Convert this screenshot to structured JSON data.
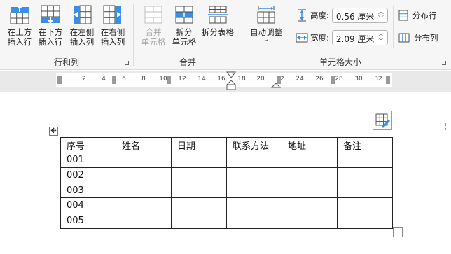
{
  "ribbon": {
    "rows_columns": {
      "group_label": "行和列",
      "buttons": [
        {
          "label": "在上方\n插入行",
          "icon": "insert-row-above-icon"
        },
        {
          "label": "在下方\n插入行",
          "icon": "insert-row-below-icon"
        },
        {
          "label": "在左侧\n插入列",
          "icon": "insert-column-left-icon"
        },
        {
          "label": "在右侧\n插入列",
          "icon": "insert-column-right-icon"
        }
      ]
    },
    "merge": {
      "group_label": "合并",
      "buttons": [
        {
          "label": "合并\n单元格",
          "icon": "merge-cells-icon",
          "disabled": true
        },
        {
          "label": "拆分\n单元格",
          "icon": "split-cells-icon"
        },
        {
          "label": "拆分表格",
          "icon": "split-table-icon"
        }
      ]
    },
    "cell_size": {
      "group_label": "单元格大小",
      "autofit_label": "自动调整",
      "autofit_arrow": "⌄",
      "height_label": "高度:",
      "height_value": "0.56 厘米",
      "width_label": "宽度:",
      "width_value": "2.09 厘米",
      "distribute_rows_label": "分布行",
      "distribute_cols_label": "分布列"
    }
  },
  "ruler": {
    "numbers": [
      "2",
      "4",
      "6",
      "8",
      "10",
      "12",
      "14",
      "16",
      "18",
      "20",
      "22",
      "24",
      "26",
      "28",
      "30",
      "32"
    ]
  },
  "table": {
    "headers": [
      "序号",
      "姓名",
      "日期",
      "联系方法",
      "地址",
      "备注"
    ],
    "rows": [
      [
        "001",
        "",
        "",
        "",
        "",
        ""
      ],
      [
        "002",
        "",
        "",
        "",
        "",
        ""
      ],
      [
        "003",
        "",
        "",
        "",
        "",
        ""
      ],
      [
        "004",
        "",
        "",
        "",
        "",
        ""
      ],
      [
        "005",
        "",
        "",
        "",
        "",
        ""
      ]
    ]
  },
  "colors": {
    "accent_blue": "#3a8ee6",
    "ribbon_bg": "#f6f6f6",
    "grid_line": "#222222"
  }
}
